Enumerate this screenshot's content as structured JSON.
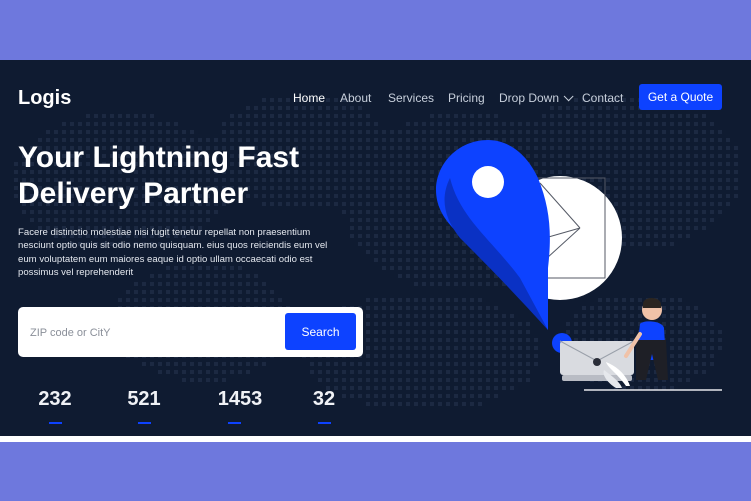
{
  "brand": {
    "logo": "Logis"
  },
  "nav": {
    "items": [
      {
        "label": "Home",
        "active": true
      },
      {
        "label": "About"
      },
      {
        "label": "Services"
      },
      {
        "label": "Pricing"
      },
      {
        "label": "Drop Down",
        "dropdown": true
      },
      {
        "label": "Contact"
      }
    ],
    "cta": "Get a Quote"
  },
  "hero": {
    "title_line1": "Your Lightning Fast",
    "title_line2": "Delivery Partner",
    "description": "Facere distinctio molestiae nisi fugit tenetur repellat non praesentium nesciunt optio quis sit odio nemo quisquam. eius quos reiciendis eum vel eum voluptatem eum maiores eaque id optio ullam occaecati odio est possimus vel reprehenderit"
  },
  "search": {
    "placeholder": "ZIP code or CitY",
    "value": "",
    "button": "Search"
  },
  "stats": [
    {
      "value": "232"
    },
    {
      "value": "521"
    },
    {
      "value": "1453"
    },
    {
      "value": "32"
    }
  ],
  "colors": {
    "background_outer": "#6e78dd",
    "hero_bg": "#0f1b31",
    "accent": "#0d42ff",
    "text": "#ffffff"
  }
}
